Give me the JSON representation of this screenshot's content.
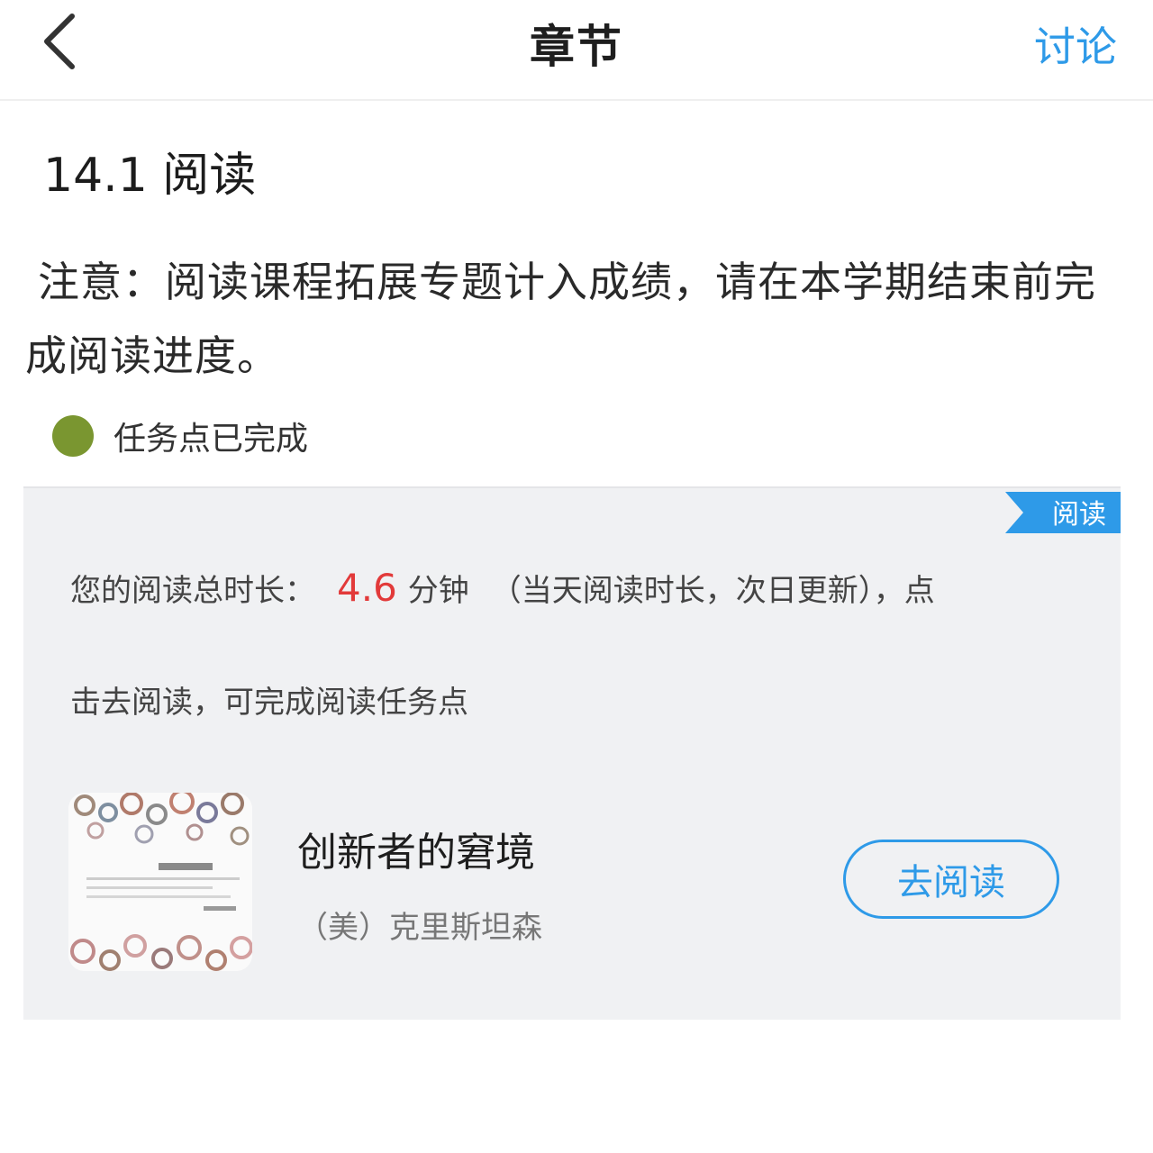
{
  "header": {
    "title": "章节",
    "action_label": "讨论",
    "back_icon": "chevron-left-icon"
  },
  "section": {
    "title": "14.1 阅读"
  },
  "notice": {
    "text": "注意：阅读课程拓展专题计入成绩，请在本学期结束前完成阅读进度。"
  },
  "task": {
    "status_text": "任务点已完成",
    "status_color": "#7a9630"
  },
  "card": {
    "ribbon_label": "阅读",
    "reading_prefix": "您的阅读总时长：",
    "reading_minutes": "4.6",
    "reading_unit": "分钟",
    "reading_suffix": "（当天阅读时长，次日更新），点",
    "reading_line2": "击去阅读，可完成阅读任务点",
    "book": {
      "title": "创新者的窘境",
      "author": "（美）克里斯坦森",
      "cover_icon": "book-cover-image"
    },
    "read_button_label": "去阅读"
  },
  "colors": {
    "accent": "#2e9ae8",
    "highlight": "#e23a3a",
    "card_bg": "#f0f1f3"
  }
}
